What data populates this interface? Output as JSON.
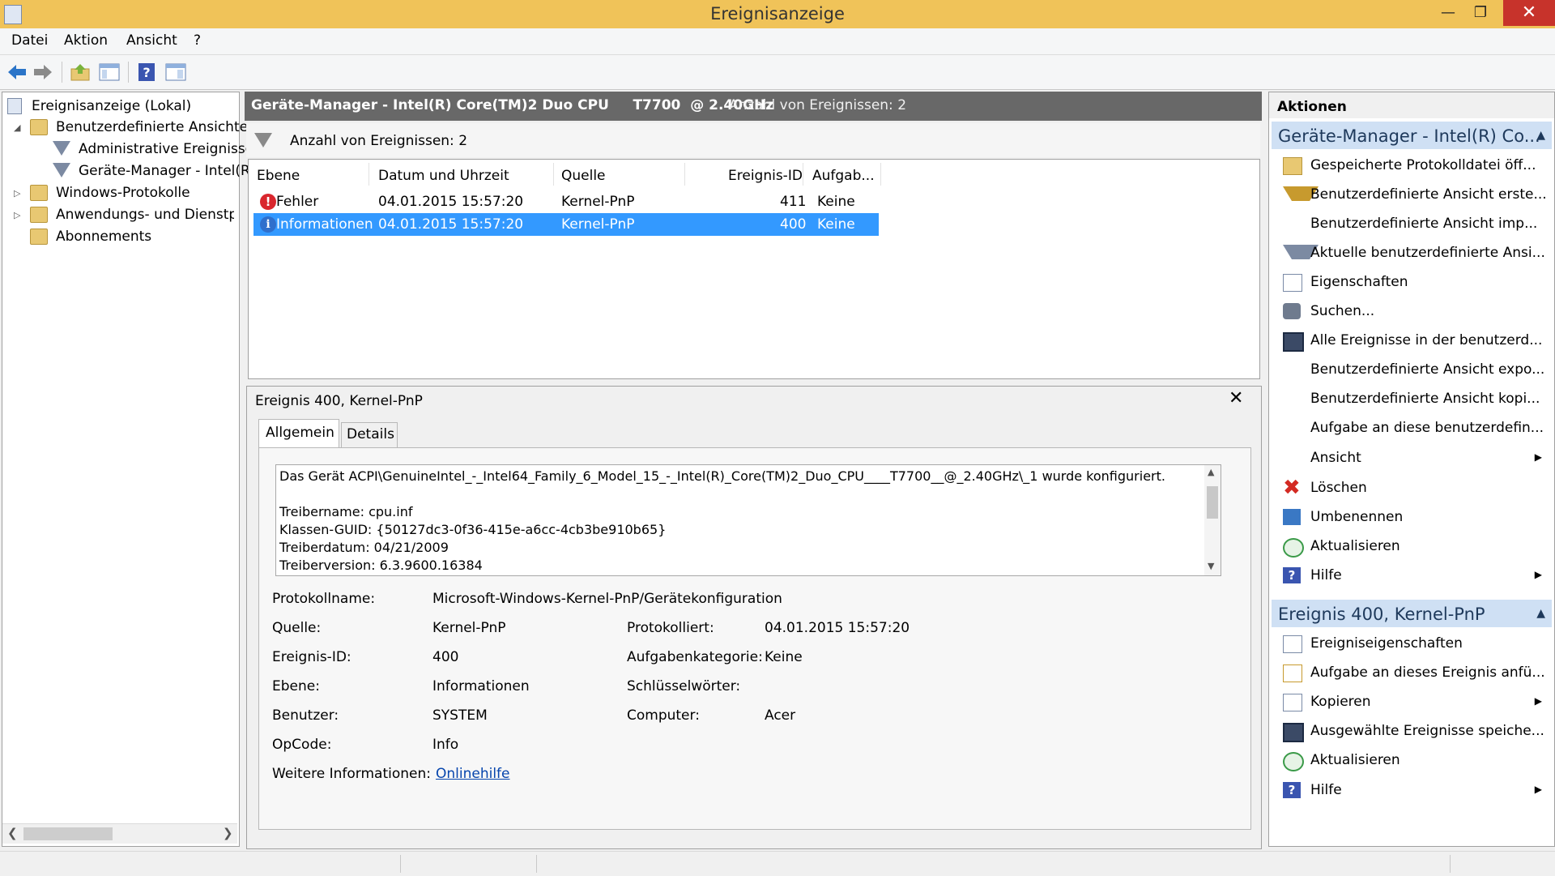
{
  "window": {
    "title": "Ereignisanzeige"
  },
  "menu": [
    "Datei",
    "Aktion",
    "Ansicht",
    "?"
  ],
  "toolbar": {
    "icons": [
      "back-arrow-icon",
      "forward-arrow-icon",
      "folder-up-icon",
      "console-tree-icon",
      "help-icon",
      "action-pane-icon"
    ],
    "colors": {
      "arrow": "#2a74c8",
      "folder": "#7bb33c"
    }
  },
  "tree": {
    "root": "Ereignisanzeige (Lokal)",
    "custom_views": "Benutzerdefinierte Ansichten",
    "admin_events": "Administrative Ereignisse",
    "device_manager": "Geräte-Manager - Intel(R",
    "windows_logs": "Windows-Protokolle",
    "app_logs": "Anwendungs- und Dienstprotokolle",
    "subscriptions": "Abonnements"
  },
  "center": {
    "header_title": "Geräte-Manager - Intel(R) Core(TM)2 Duo CPU     T7700  @ 2.40GHz",
    "header_count": "Anzahl von Ereignissen: 2",
    "filter_text": "Anzahl von Ereignissen: 2",
    "columns": [
      "Ebene",
      "Datum und Uhrzeit",
      "Quelle",
      "Ereignis-ID",
      "Aufgab..."
    ],
    "events": [
      {
        "level": "Fehler",
        "datetime": "04.01.2015 15:57:20",
        "source": "Kernel-PnP",
        "id": "411",
        "task": "Keine"
      },
      {
        "level": "Informationen",
        "datetime": "04.01.2015 15:57:20",
        "source": "Kernel-PnP",
        "id": "400",
        "task": "Keine"
      }
    ]
  },
  "detail": {
    "title": "Ereignis 400, Kernel-PnP",
    "tabs": [
      "Allgemein",
      "Details"
    ],
    "description": [
      "Das Gerät ACPI\\GenuineIntel_-_Intel64_Family_6_Model_15_-_Intel(R)_Core(TM)2_Duo_CPU____T7700__@_2.40GHz\\_1 wurde konfiguriert.",
      "",
      "Treibername: cpu.inf",
      "Klassen-GUID: {50127dc3-0f36-415e-a6cc-4cb3be910b65}",
      "Treiberdatum: 04/21/2009",
      "Treiberversion: 6.3.9600.16384"
    ],
    "labels": {
      "log_name": "Protokollname:",
      "source": "Quelle:",
      "event_id": "Ereignis-ID:",
      "level": "Ebene:",
      "user": "Benutzer:",
      "opcode": "OpCode:",
      "more_info": "Weitere Informationen:",
      "logged": "Protokolliert:",
      "task_category": "Aufgabenkategorie:",
      "keywords": "Schlüsselwörter:",
      "computer": "Computer:"
    },
    "values": {
      "log_name": "Microsoft-Windows-Kernel-PnP/Gerätekonfiguration",
      "source": "Kernel-PnP",
      "event_id": "400",
      "level": "Informationen",
      "user": "SYSTEM",
      "opcode": "Info",
      "more_info_link": "Onlinehilfe",
      "logged": "04.01.2015 15:57:20",
      "task_category": "Keine",
      "keywords": "",
      "computer": "Acer"
    }
  },
  "actions": {
    "header": "Aktionen",
    "section1": {
      "title": "Geräte-Manager - Intel(R) Co...",
      "items": [
        {
          "label": "Gespeicherte Protokolldatei öff...",
          "icon": "open-folder-icon"
        },
        {
          "label": "Benutzerdefinierte Ansicht erste...",
          "icon": "create-filter-icon"
        },
        {
          "label": "Benutzerdefinierte Ansicht imp...",
          "icon": ""
        },
        {
          "label": "Aktuelle benutzerdefinierte Ansi...",
          "icon": "filter-icon"
        },
        {
          "label": "Eigenschaften",
          "icon": "properties-icon"
        },
        {
          "label": "Suchen...",
          "icon": "binoculars-icon"
        },
        {
          "label": "Alle Ereignisse in der benutzerd...",
          "icon": "save-icon"
        },
        {
          "label": "Benutzerdefinierte Ansicht expo...",
          "icon": ""
        },
        {
          "label": "Benutzerdefinierte Ansicht kopi...",
          "icon": ""
        },
        {
          "label": "Aufgabe an diese benutzerdefin...",
          "icon": ""
        },
        {
          "label": "Ansicht",
          "icon": "",
          "submenu": true
        },
        {
          "label": "Löschen",
          "icon": "delete-icon"
        },
        {
          "label": "Umbenennen",
          "icon": "rename-icon"
        },
        {
          "label": "Aktualisieren",
          "icon": "refresh-icon"
        },
        {
          "label": "Hilfe",
          "icon": "help-icon",
          "submenu": true
        }
      ]
    },
    "section2": {
      "title": "Ereignis 400, Kernel-PnP",
      "items": [
        {
          "label": "Ereigniseigenschaften",
          "icon": "properties-icon"
        },
        {
          "label": "Aufgabe an dieses Ereignis anfü...",
          "icon": "task-icon"
        },
        {
          "label": "Kopieren",
          "icon": "copy-icon",
          "submenu": true
        },
        {
          "label": "Ausgewählte Ereignisse speiche...",
          "icon": "save-icon"
        },
        {
          "label": "Aktualisieren",
          "icon": "refresh-icon"
        },
        {
          "label": "Hilfe",
          "icon": "help-icon",
          "submenu": true
        }
      ]
    }
  }
}
